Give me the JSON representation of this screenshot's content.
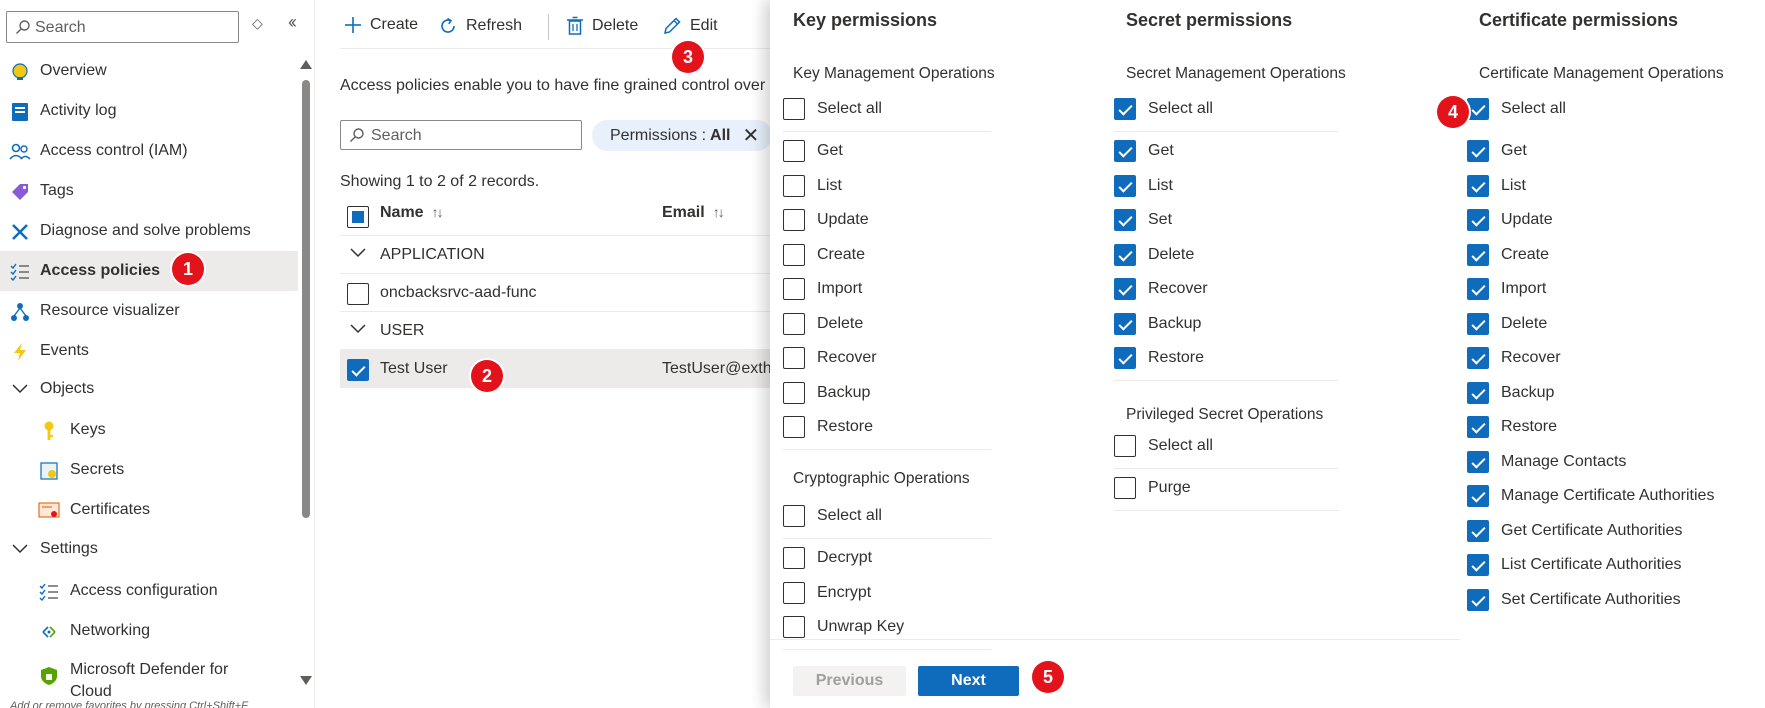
{
  "sidebar": {
    "search_placeholder": "Search",
    "items": [
      {
        "label": "Overview",
        "icon": "lightbulb-icon"
      },
      {
        "label": "Activity log",
        "icon": "activity-log-icon"
      },
      {
        "label": "Access control (IAM)",
        "icon": "people-icon"
      },
      {
        "label": "Tags",
        "icon": "tag-icon"
      },
      {
        "label": "Diagnose and solve problems",
        "icon": "wrench-icon"
      },
      {
        "label": "Access policies",
        "icon": "list-check-icon",
        "active": true
      },
      {
        "label": "Resource visualizer",
        "icon": "hierarchy-icon"
      },
      {
        "label": "Events",
        "icon": "lightning-icon"
      },
      {
        "label": "Objects",
        "expander": true
      },
      {
        "label": "Keys",
        "icon": "key-icon"
      },
      {
        "label": "Secrets",
        "icon": "secret-icon"
      },
      {
        "label": "Certificates",
        "icon": "certificate-icon"
      },
      {
        "label": "Settings",
        "expander": true
      },
      {
        "label": "Access configuration",
        "icon": "list-check-icon"
      },
      {
        "label": "Networking",
        "icon": "network-icon"
      },
      {
        "label": "Microsoft Defender for Cloud",
        "icon": "shield-icon"
      }
    ],
    "footer": "Add or remove favorites by pressing Ctrl+Shift+F"
  },
  "toolbar": {
    "create": "Create",
    "refresh": "Refresh",
    "delete": "Delete",
    "edit": "Edit"
  },
  "main": {
    "description": "Access policies enable you to have fine grained control over",
    "search_placeholder": "Search",
    "filter_label": "Permissions :",
    "filter_value": "All",
    "records": "Showing 1 to 2 of 2 records.",
    "col_name": "Name",
    "col_email": "Email",
    "groups": [
      {
        "label": "APPLICATION",
        "rows": [
          {
            "name": "oncbacksrvc-aad-func",
            "email": "",
            "checked": false
          }
        ]
      },
      {
        "label": "USER",
        "rows": [
          {
            "name": "Test User",
            "email": "TestUser@exth",
            "checked": true
          }
        ]
      }
    ]
  },
  "panel": {
    "key": {
      "title": "Key permissions",
      "mgmt_label": "Key Management Operations",
      "select_all": "Select all",
      "mgmt_items": [
        "Get",
        "List",
        "Update",
        "Create",
        "Import",
        "Delete",
        "Recover",
        "Backup",
        "Restore"
      ],
      "crypto_label": "Cryptographic Operations",
      "crypto_items": [
        "Decrypt",
        "Encrypt",
        "Unwrap Key"
      ]
    },
    "secret": {
      "title": "Secret permissions",
      "mgmt_label": "Secret Management Operations",
      "select_all": "Select all",
      "mgmt_items": [
        "Get",
        "List",
        "Set",
        "Delete",
        "Recover",
        "Backup",
        "Restore"
      ],
      "priv_label": "Privileged Secret Operations",
      "priv_items": [
        "Purge"
      ]
    },
    "cert": {
      "title": "Certificate permissions",
      "mgmt_label": "Certificate Management Operations",
      "select_all": "Select all",
      "mgmt_items": [
        "Get",
        "List",
        "Update",
        "Create",
        "Import",
        "Delete",
        "Recover",
        "Backup",
        "Restore",
        "Manage Contacts",
        "Manage Certificate Authorities",
        "Get Certificate Authorities",
        "List Certificate Authorities",
        "Set Certificate Authorities"
      ]
    },
    "previous": "Previous",
    "next": "Next"
  },
  "badges": [
    "1",
    "2",
    "3",
    "4",
    "5"
  ],
  "colors": {
    "accent": "#0f6cbd",
    "badge": "#e3131b",
    "selected_row": "#edebe9",
    "pill": "#e7f0fb"
  }
}
